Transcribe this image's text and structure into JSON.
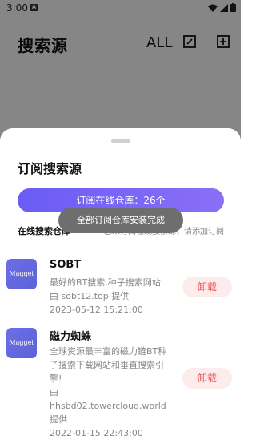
{
  "status": {
    "time": "3:00",
    "badge": "A"
  },
  "appbar": {
    "title": "搜索源",
    "all_label": "ALL"
  },
  "sheet": {
    "title": "订阅搜索源",
    "repo_button": "订阅在线仓库：26个",
    "online_label": "在线搜索仓库",
    "hint": "您未订阅在线搜索源，请添加订阅",
    "toast": "全部订阅仓库安装完成",
    "items": [
      {
        "logo": "Magget",
        "name": "SOBT",
        "desc_lines": [
          "最好的BT搜索,种子搜索网站",
          "由 sobt12.top 提供",
          "2023-05-12 15:21:00"
        ],
        "action": "卸载"
      },
      {
        "logo": "Magget",
        "name": "磁力蜘蛛",
        "desc_lines": [
          "全球资源最丰富的磁力链BT种",
          "子搜索下载网站和垂直搜索引",
          "擎!",
          "由 hhsbd02.towercloud.world",
          "提供",
          "2022-01-15 22:43:00"
        ],
        "action": "卸载"
      }
    ]
  }
}
